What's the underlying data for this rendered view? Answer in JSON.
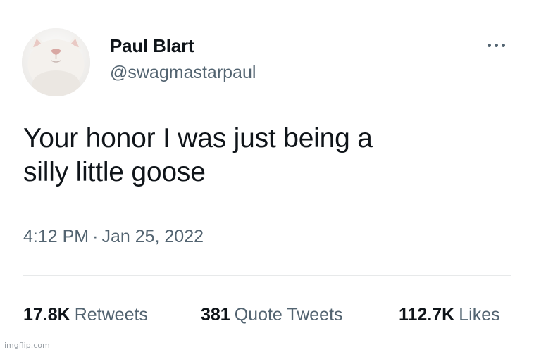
{
  "author": {
    "display_name": "Paul Blart",
    "handle": "@swagmastarpaul",
    "avatar_icon": "cat-face-avatar"
  },
  "menu": {
    "more_icon": "more-options-icon"
  },
  "tweet": {
    "text_lines": [
      "Your honor I was just being a",
      "silly little goose"
    ],
    "time": "4:12 PM",
    "separator": "·",
    "date": "Jan 25, 2022"
  },
  "stats": {
    "retweets": {
      "count": "17.8K",
      "label": "Retweets"
    },
    "quote_tweets": {
      "count": "381",
      "label": "Quote Tweets"
    },
    "likes": {
      "count": "112.7K",
      "label": "Likes"
    }
  },
  "watermark": "imgflip.com",
  "colors": {
    "text_primary": "#0f1419",
    "text_secondary": "#536471",
    "divider": "#e7e9ea",
    "background": "#ffffff"
  }
}
